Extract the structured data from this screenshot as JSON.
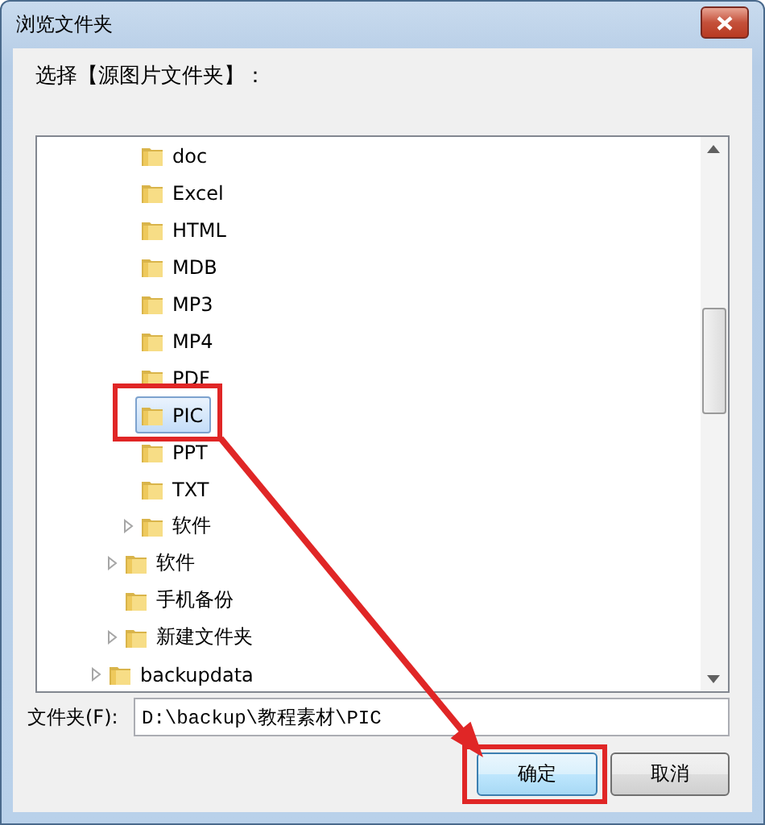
{
  "window": {
    "title": "浏览文件夹"
  },
  "prompt": "选择【源图片文件夹】：",
  "tree": {
    "items": [
      {
        "children": [
          {
            "children": [
              {
                "label": "doc",
                "expandable": false,
                "selected": false
              },
              {
                "label": "Excel",
                "expandable": false,
                "selected": false
              },
              {
                "label": "HTML",
                "expandable": false,
                "selected": false
              },
              {
                "label": "MDB",
                "expandable": false,
                "selected": false
              },
              {
                "label": "MP3",
                "expandable": false,
                "selected": false
              },
              {
                "label": "MP4",
                "expandable": false,
                "selected": false
              },
              {
                "label": "PDF",
                "expandable": false,
                "selected": false
              },
              {
                "label": "PIC",
                "expandable": false,
                "selected": true
              },
              {
                "label": "PPT",
                "expandable": false,
                "selected": false
              },
              {
                "label": "TXT",
                "expandable": false,
                "selected": false
              },
              {
                "label": "软件",
                "expandable": true,
                "selected": false
              }
            ]
          },
          {
            "label": "软件",
            "expandable": true,
            "selected": false
          },
          {
            "label": "手机备份",
            "expandable": false,
            "selected": false
          },
          {
            "label": "新建文件夹",
            "expandable": true,
            "selected": false
          }
        ]
      },
      {
        "label": "backupdata",
        "expandable": true,
        "selected": false
      }
    ]
  },
  "folder_field": {
    "label": "文件夹(F):",
    "value": "D:\\backup\\教程素材\\PIC"
  },
  "buttons": [
    {
      "label": "确定",
      "default": true
    },
    {
      "label": "取消",
      "default": false
    }
  ]
}
